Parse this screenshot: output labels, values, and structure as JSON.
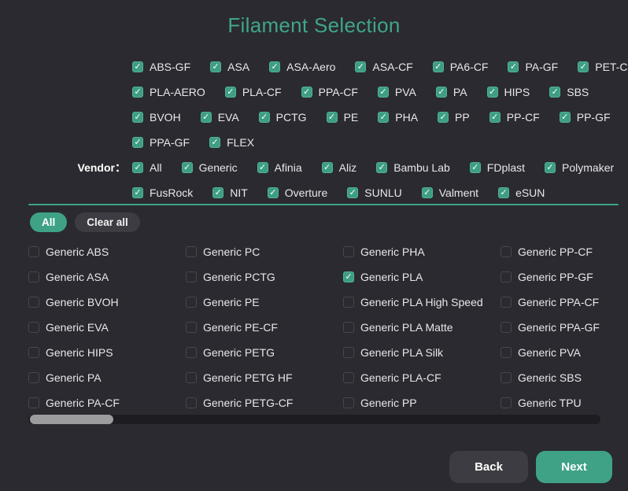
{
  "title": "Filament Selection",
  "colors": {
    "background": "#2a2a30",
    "accent": "#3fa287",
    "checkbox_checked": "#3d9e84",
    "title_text": "#41a58a",
    "label_text": "#e8e8ea"
  },
  "filament_rows": [
    [
      "ABS-GF",
      "ASA",
      "ASA-Aero",
      "ASA-CF",
      "PA6-CF",
      "PA-GF",
      "PET-CF"
    ],
    [
      "PLA-AERO",
      "PLA-CF",
      "PPA-CF",
      "PVA",
      "PA",
      "HIPS",
      "SBS"
    ],
    [
      "BVOH",
      "EVA",
      "PCTG",
      "PE",
      "PHA",
      "PP",
      "PP-CF",
      "PP-GF"
    ],
    [
      "PPA-GF",
      "FLEX"
    ]
  ],
  "filament_all_checked": true,
  "vendor": {
    "label": "Vendor：",
    "rows": [
      [
        "All",
        "Generic",
        "Afinia",
        "Aliz",
        "Bambu Lab",
        "FDplast",
        "Polymaker"
      ],
      [
        "FusRock",
        "NIT",
        "Overture",
        "SUNLU",
        "Valment",
        "eSUN"
      ]
    ],
    "all_checked": true
  },
  "filter_bar": {
    "all_label": "All",
    "clear_all_label": "Clear all"
  },
  "grid": {
    "rows": [
      [
        {
          "label": "Generic ABS",
          "checked": false
        },
        {
          "label": "Generic PC",
          "checked": false
        },
        {
          "label": "Generic PHA",
          "checked": false
        },
        {
          "label": "Generic PP-CF",
          "checked": false
        }
      ],
      [
        {
          "label": "Generic ASA",
          "checked": false
        },
        {
          "label": "Generic PCTG",
          "checked": false
        },
        {
          "label": "Generic PLA",
          "checked": true
        },
        {
          "label": "Generic PP-GF",
          "checked": false
        }
      ],
      [
        {
          "label": "Generic BVOH",
          "checked": false
        },
        {
          "label": "Generic PE",
          "checked": false
        },
        {
          "label": "Generic PLA High Speed",
          "checked": false
        },
        {
          "label": "Generic PPA-CF",
          "checked": false
        }
      ],
      [
        {
          "label": "Generic EVA",
          "checked": false
        },
        {
          "label": "Generic PE-CF",
          "checked": false
        },
        {
          "label": "Generic PLA Matte",
          "checked": false
        },
        {
          "label": "Generic PPA-GF",
          "checked": false
        }
      ],
      [
        {
          "label": "Generic HIPS",
          "checked": false
        },
        {
          "label": "Generic PETG",
          "checked": false
        },
        {
          "label": "Generic PLA Silk",
          "checked": false
        },
        {
          "label": "Generic PVA",
          "checked": false
        }
      ],
      [
        {
          "label": "Generic PA",
          "checked": false
        },
        {
          "label": "Generic PETG HF",
          "checked": false
        },
        {
          "label": "Generic PLA-CF",
          "checked": false
        },
        {
          "label": "Generic SBS",
          "checked": false
        }
      ],
      [
        {
          "label": "Generic PA-CF",
          "checked": false
        },
        {
          "label": "Generic PETG-CF",
          "checked": false
        },
        {
          "label": "Generic PP",
          "checked": false
        },
        {
          "label": "Generic TPU",
          "checked": false
        }
      ]
    ]
  },
  "footer": {
    "back_label": "Back",
    "next_label": "Next"
  }
}
